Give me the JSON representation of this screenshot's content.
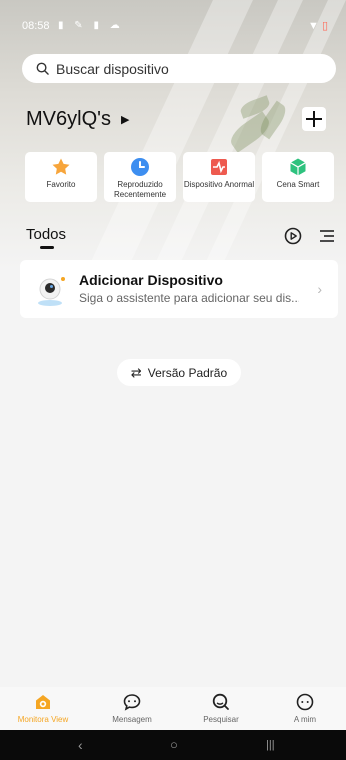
{
  "status_bar": {
    "time": "08:58"
  },
  "search": {
    "placeholder": "Buscar dispositivo"
  },
  "home": {
    "name": "MV6ylQ's"
  },
  "quick_actions": [
    {
      "label": "Favorito",
      "icon": "star-icon"
    },
    {
      "label": "Reproduzido Recentemente",
      "icon": "clock-icon"
    },
    {
      "label": "Dispositivo Anormal",
      "icon": "alert-device-icon"
    },
    {
      "label": "Cena Smart",
      "icon": "cube-icon"
    }
  ],
  "section": {
    "title": "Todos"
  },
  "device_card": {
    "title": "Adicionar Dispositivo",
    "subtitle": "Siga o assistente para adicionar seu dis..."
  },
  "version_button": {
    "label": "Versão Padrão"
  },
  "tabs": [
    {
      "label": "Monitora View",
      "icon": "home-camera-icon",
      "active": true
    },
    {
      "label": "Mensagem",
      "icon": "chat-icon",
      "active": false
    },
    {
      "label": "Pesquisar",
      "icon": "search-icon",
      "active": false
    },
    {
      "label": "A mim",
      "icon": "profile-icon",
      "active": false
    }
  ],
  "colors": {
    "accent": "#f5a623",
    "background": "#f4f4f4"
  }
}
